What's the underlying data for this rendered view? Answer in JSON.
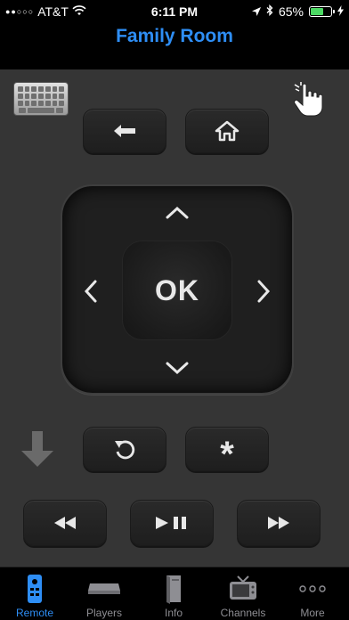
{
  "status_bar": {
    "signal_dots": "●●○○○",
    "carrier": "AT&T",
    "time": "6:11 PM",
    "battery_percent": "65%",
    "battery_level": 0.65,
    "battery_color": "#4cd964"
  },
  "nav": {
    "title": "Family Room",
    "title_color": "#2e8ef5"
  },
  "remote": {
    "keyboard_icon": "keyboard-icon",
    "gesture_icon": "hand-pointer-icon",
    "back_icon": "back-arrow-icon",
    "home_icon": "home-icon",
    "ok_label": "OK",
    "up_icon": "chevron-up-icon",
    "down_icon": "chevron-down-icon",
    "left_icon": "chevron-left-icon",
    "right_icon": "chevron-right-icon",
    "replay_icon": "replay-icon",
    "options_label": "*",
    "rewind_icon": "rewind-icon",
    "play_pause_icon": "play-pause-icon",
    "fast_forward_icon": "fast-forward-icon",
    "volume_icon": "down-arrow-icon"
  },
  "tabs": [
    {
      "label": "Remote",
      "icon": "remote-icon",
      "active": true
    },
    {
      "label": "Players",
      "icon": "player-box-icon",
      "active": false
    },
    {
      "label": "Info",
      "icon": "book-icon",
      "active": false
    },
    {
      "label": "Channels",
      "icon": "tv-icon",
      "active": false
    },
    {
      "label": "More",
      "icon": "more-dots-icon",
      "active": false
    }
  ],
  "accent_color": "#2e8ef5"
}
